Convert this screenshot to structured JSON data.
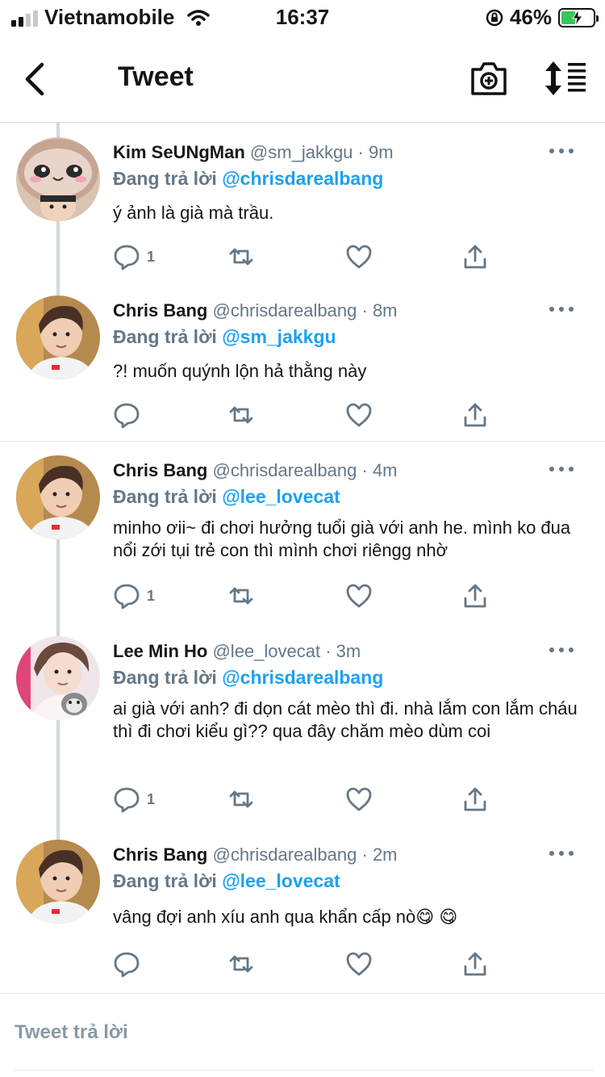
{
  "status_bar": {
    "carrier": "Vietnamobile",
    "time": "16:37",
    "battery": "46%",
    "battery_level": 0.46
  },
  "header": {
    "title": "Tweet"
  },
  "tweets": [
    {
      "name": "Kim SeUNgMan",
      "handle": "@sm_jakkgu",
      "time": "· 9m",
      "reply_label": "Đang trả lời",
      "reply_to": "@chrisdarealbang",
      "text": "ý ảnh là già mà trầu.",
      "reply_count": "1"
    },
    {
      "name": "Chris Bang",
      "handle": "@chrisdarealbang",
      "time": "· 8m",
      "reply_label": "Đang trả lời",
      "reply_to": "@sm_jakkgu",
      "text": "?! muốn quýnh lộn hả thằng này",
      "reply_count": ""
    },
    {
      "name": "Chris Bang",
      "handle": "@chrisdarealbang",
      "time": "· 4m",
      "reply_label": "Đang trả lời",
      "reply_to": "@lee_lovecat",
      "text": "minho ơii~ đi chơi hưởng tuổi già với anh he. mình ko đua nổi zới tụi trẻ con thì mình chơi riêngg nhờ",
      "reply_count": "1"
    },
    {
      "name": "Lee Min Ho",
      "handle": "@lee_lovecat",
      "time": "· 3m",
      "reply_label": "Đang trả lời",
      "reply_to": "@chrisdarealbang",
      "text": "ai già với anh? đi dọn cát mèo thì đi. nhà lắm con lắm cháu thì đi chơi kiểu gì?? qua đây chăm mèo dùm coi",
      "reply_count": "1"
    },
    {
      "name": "Chris Bang",
      "handle": "@chrisdarealbang",
      "time": "· 2m",
      "reply_label": "Đang trả lời",
      "reply_to": "@lee_lovecat",
      "text": "vâng đợi anh xíu anh qua khẩn cấp nò😋 😋",
      "reply_count": ""
    }
  ],
  "compose": {
    "placeholder": "Tweet trả lời"
  },
  "colors": {
    "accent": "#1da1f2",
    "muted": "#657786",
    "battery": "#34c759"
  }
}
